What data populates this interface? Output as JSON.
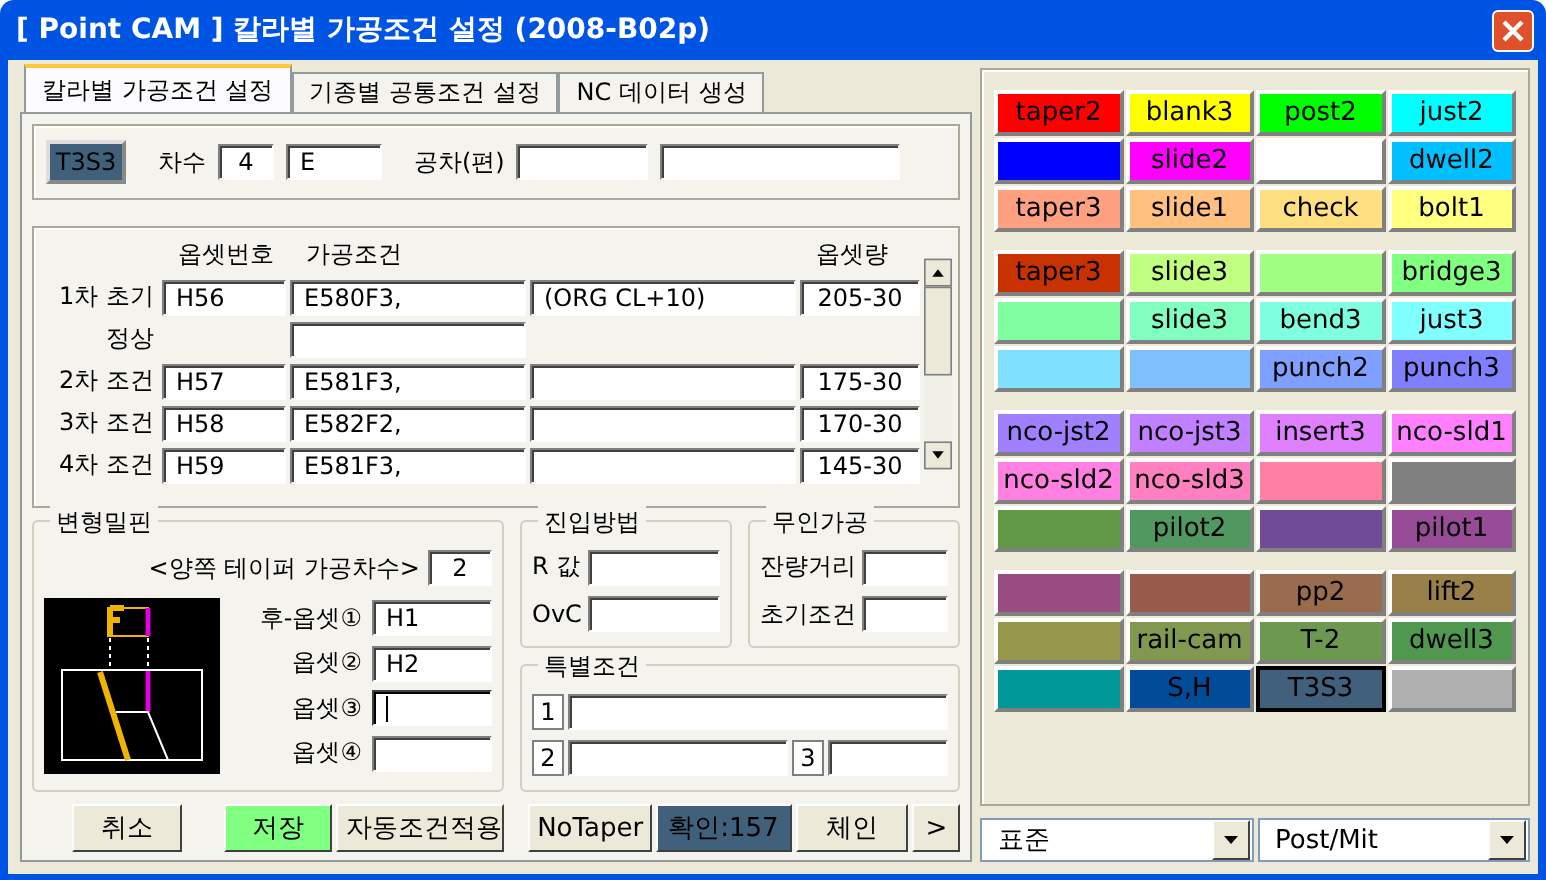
{
  "window": {
    "title": "[ Point CAM ]  칼라별 가공조건 설정  (2008-B02p)"
  },
  "tabs": [
    {
      "label": "칼라별 가공조건 설정",
      "selected": true
    },
    {
      "label": "기종별 공통조건 설정",
      "selected": false
    },
    {
      "label": "NC 데이터 생성",
      "selected": false
    }
  ],
  "header": {
    "color_button": {
      "label": "T3S3",
      "color": "#40607c"
    },
    "order_label": "차수",
    "order_values": [
      "4",
      "E"
    ],
    "tolerance_label": "공차(편)",
    "tolerance_fields": [
      {
        "kind": "short"
      },
      {
        "kind": "long"
      }
    ]
  },
  "table": {
    "columns": [
      "옵셋번호",
      "가공조건",
      "옵셋량"
    ],
    "rows": [
      {
        "kind": "full",
        "label": "1차 초기",
        "offset": "H56",
        "condition": "E580F3,",
        "note": "(ORG CL+10)",
        "amount": "205-30"
      },
      {
        "kind": "condition_only",
        "label": "정상"
      },
      {
        "kind": "full",
        "label": "2차 조건",
        "offset": "H57",
        "condition": "E581F3,",
        "amount": "175-30"
      },
      {
        "kind": "full",
        "label": "3차 조건",
        "offset": "H58",
        "condition": "E582F2,",
        "amount": "170-30"
      },
      {
        "kind": "full",
        "label": "4차 조건",
        "offset": "H59",
        "condition": "E581F3,",
        "amount": "145-30"
      }
    ]
  },
  "taper_pin": {
    "title": "변형밀핀",
    "count_label": "<양쪽 테이퍼 가공차수>",
    "count_value": "2",
    "offsets": [
      {
        "label": "후-옵셋①",
        "value": "H1",
        "focused": false
      },
      {
        "label": "옵셋②",
        "value": "H2",
        "focused": false
      },
      {
        "label": "옵셋③",
        "focused": true
      },
      {
        "label": "옵셋④",
        "focused": false
      }
    ]
  },
  "approach": {
    "title": "진입방법",
    "fields": [
      {
        "label": "R 값"
      },
      {
        "label": "OvC"
      }
    ]
  },
  "unattended": {
    "title": "무인가공",
    "fields": [
      {
        "label": "잔량거리"
      },
      {
        "label": "초기조건"
      }
    ]
  },
  "special": {
    "title": "특별조건",
    "fields": [
      {
        "label": "1"
      },
      {
        "label": "2"
      },
      {
        "label": "3"
      }
    ]
  },
  "buttons": [
    {
      "label": "취소",
      "kind": "plain"
    },
    {
      "label": "저장",
      "kind": "green"
    },
    {
      "label": "자동조건적용",
      "kind": "plain"
    },
    {
      "label": "NoTaper",
      "kind": "plain"
    },
    {
      "label": "확인:157",
      "kind": "dark"
    },
    {
      "label": "체인",
      "kind": "plain"
    },
    {
      "label": ">",
      "kind": "plain"
    }
  ],
  "color_groups": [
    [
      {
        "label": "taper2",
        "color": "#ff0000",
        "selected": false
      },
      {
        "label": "blank3",
        "color": "#ffff00",
        "selected": false
      },
      {
        "label": "post2",
        "color": "#00ff00",
        "selected": false
      },
      {
        "label": "just2",
        "color": "#00ffff",
        "selected": false
      },
      {
        "color": "#0000ff",
        "selected": false
      },
      {
        "label": "slide2",
        "color": "#ff00ff",
        "selected": false
      },
      {
        "color": "#ffffff",
        "selected": false
      },
      {
        "label": "dwell2",
        "color": "#00c0ff",
        "selected": false
      },
      {
        "label": "taper3",
        "color": "#ffa080",
        "selected": false
      },
      {
        "label": "slide1",
        "color": "#ffc080",
        "selected": false
      },
      {
        "label": "check",
        "color": "#ffe080",
        "selected": false
      },
      {
        "label": "bolt1",
        "color": "#ffff80",
        "selected": false
      }
    ],
    [
      {
        "label": "taper3",
        "color": "#c83200",
        "selected": false
      },
      {
        "label": "slide3",
        "color": "#c0ff80",
        "selected": false
      },
      {
        "color": "#a0ff80",
        "selected": false
      },
      {
        "label": "bridge3",
        "color": "#80ff80",
        "selected": false
      },
      {
        "color": "#80ffa0",
        "selected": false
      },
      {
        "label": "slide3",
        "color": "#80ffc0",
        "selected": false
      },
      {
        "label": "bend3",
        "color": "#80ffe0",
        "selected": false
      },
      {
        "label": "just3",
        "color": "#80ffff",
        "selected": false
      },
      {
        "color": "#80e0ff",
        "selected": false
      },
      {
        "color": "#80c0ff",
        "selected": false
      },
      {
        "label": "punch2",
        "color": "#80a0ff",
        "selected": false
      },
      {
        "label": "punch3",
        "color": "#8080ff",
        "selected": false
      }
    ],
    [
      {
        "label": "nco-jst2",
        "color": "#a080ff",
        "selected": false
      },
      {
        "label": "nco-jst3",
        "color": "#c080ff",
        "selected": false
      },
      {
        "label": "insert3",
        "color": "#e080ff",
        "selected": false
      },
      {
        "label": "nco-sld1",
        "color": "#ff80ff",
        "selected": false
      },
      {
        "label": "nco-sld2",
        "color": "#ff80e0",
        "selected": false
      },
      {
        "label": "nco-sld3",
        "color": "#ff80c0",
        "selected": false
      },
      {
        "color": "#ff80a0",
        "selected": false
      },
      {
        "color": "#808080",
        "selected": false
      },
      {
        "color": "#609848",
        "selected": false
      },
      {
        "label": "pilot2",
        "color": "#509860",
        "selected": false
      },
      {
        "color": "#704c98",
        "selected": false
      },
      {
        "label": "pilot1",
        "color": "#984c98",
        "selected": false
      }
    ],
    [
      {
        "color": "#984c80",
        "selected": false
      },
      {
        "color": "#985c4c",
        "selected": false
      },
      {
        "label": "pp2",
        "color": "#986c4c",
        "selected": false
      },
      {
        "label": "lift2",
        "color": "#988048",
        "selected": false
      },
      {
        "color": "#98984c",
        "selected": false
      },
      {
        "label": "rail-cam",
        "color": "#809850",
        "selected": false
      },
      {
        "label": "T-2",
        "color": "#6c9850",
        "selected": false
      },
      {
        "label": "dwell3",
        "color": "#509850",
        "selected": false
      },
      {
        "color": "#009898",
        "selected": false
      },
      {
        "label": "S,H",
        "color": "#004c98",
        "selected": false
      },
      {
        "label": "T3S3",
        "color": "#40607c",
        "selected": true
      },
      {
        "color": "#b0b0b0",
        "selected": false
      }
    ]
  ],
  "dropdowns": [
    {
      "value": "표준"
    },
    {
      "value": "Post/Mit"
    }
  ]
}
